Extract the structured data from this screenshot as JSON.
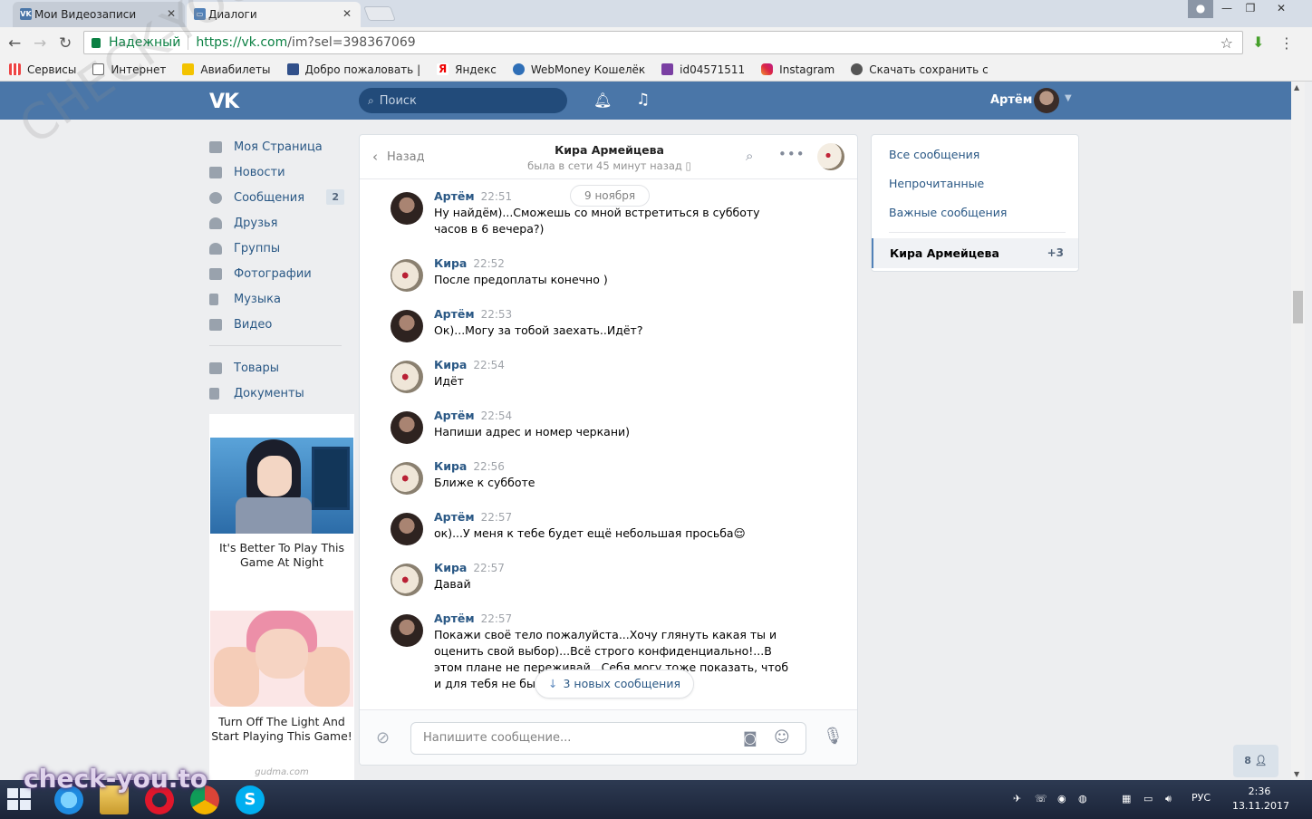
{
  "browser": {
    "tabs": [
      {
        "title": "Мои Видеозаписи",
        "active": false
      },
      {
        "title": "Диалоги",
        "active": true
      }
    ],
    "secure_label": "Надежный",
    "url_host": "https://vk.com",
    "url_path": "/im?sel=398367069",
    "bookmarks": [
      {
        "label": "Сервисы",
        "icon": "apps-grid-icon"
      },
      {
        "label": "Интернет",
        "icon": "page-icon"
      },
      {
        "label": "Авиабилеты",
        "icon": "plane-icon"
      },
      {
        "label": "Добро пожаловать |",
        "icon": "blue-square-icon"
      },
      {
        "label": "Яндекс",
        "icon": "yandex-icon"
      },
      {
        "label": "WebMoney Кошелёк",
        "icon": "webmoney-icon"
      },
      {
        "label": "id04571511",
        "icon": "purple-s-icon"
      },
      {
        "label": "Instagram",
        "icon": "instagram-icon"
      },
      {
        "label": "Скачать сохранить с",
        "icon": "eye-icon"
      }
    ]
  },
  "vk_header": {
    "logo": "vk",
    "search_placeholder": "Поиск",
    "user_name": "Артём"
  },
  "left_nav": {
    "items": [
      {
        "label": "Моя Страница",
        "icon": "home-icon"
      },
      {
        "label": "Новости",
        "icon": "news-icon"
      },
      {
        "label": "Сообщения",
        "icon": "messages-icon",
        "count": "2"
      },
      {
        "label": "Друзья",
        "icon": "friends-icon"
      },
      {
        "label": "Группы",
        "icon": "groups-icon"
      },
      {
        "label": "Фотографии",
        "icon": "camera-icon"
      },
      {
        "label": "Музыка",
        "icon": "music-icon"
      },
      {
        "label": "Видео",
        "icon": "video-icon"
      }
    ],
    "items2": [
      {
        "label": "Товары",
        "icon": "bag-icon"
      },
      {
        "label": "Документы",
        "icon": "doc-icon"
      }
    ]
  },
  "ads": [
    {
      "caption": "It's Better To Play This Game At Night"
    },
    {
      "caption": "Turn Off The Light And Start Playing This Game!"
    }
  ],
  "ads_footer": "gudma.com",
  "chat": {
    "back_label": "Назад",
    "peer_name": "Кира Армейцева",
    "peer_status": "была в сети 45 минут назад",
    "date_pill": "9 ноября",
    "messages": [
      {
        "author": "Артём",
        "time": "22:51",
        "text": "Ну найдём)...Сможешь со мной встретиться в субботу часов в 6 вечера?)"
      },
      {
        "author": "Кира",
        "time": "22:52",
        "text": "После предоплаты конечно )"
      },
      {
        "author": "Артём",
        "time": "22:53",
        "text": "Ок)...Могу за тобой заехать..Идёт?"
      },
      {
        "author": "Кира",
        "time": "22:54",
        "text": "Идёт"
      },
      {
        "author": "Артём",
        "time": "22:54",
        "text": "Напиши адрес и номер черкани)"
      },
      {
        "author": "Кира",
        "time": "22:56",
        "text": "Ближе к субботе"
      },
      {
        "author": "Артём",
        "time": "22:57",
        "text": "ок)...У меня к тебе будет ещё небольшая просьба😌"
      },
      {
        "author": "Кира",
        "time": "22:57",
        "text": "Давай"
      },
      {
        "author": "Артём",
        "time": "22:57",
        "text": "Покажи своё тело пожалуйста...Хочу глянуть какая ты и оценить свой выбор)...Всё строго конфиденциально!...В этом плане не переживай...Себя могу тоже показать, чтоб и для тебя не было сюрп"
      }
    ],
    "new_messages_pill": "3 новых сообщения",
    "composer_placeholder": "Напишите сообщение..."
  },
  "right_panel": {
    "links": [
      "Все сообщения",
      "Непрочитанные",
      "Важные сообщения"
    ],
    "active_dialog": {
      "name": "Кира Армейцева",
      "count": "+3"
    }
  },
  "online_badge": "8",
  "taskbar": {
    "lang": "РУС",
    "time": "2:36",
    "date": "13.11.2017"
  },
  "watermarks": {
    "diagonal": "CHECK-YOU.ME",
    "bottom": "check-you.to"
  }
}
